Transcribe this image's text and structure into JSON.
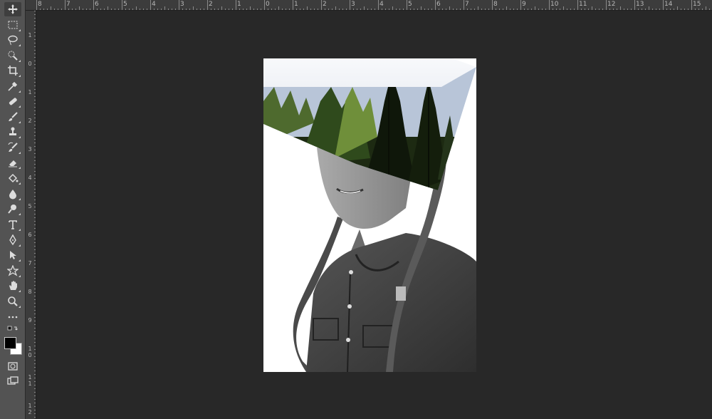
{
  "toolbar": {
    "tools": [
      {
        "name": "move-tool",
        "icon": "move-icon",
        "active": true
      },
      {
        "name": "rectangular-marquee-tool",
        "icon": "marquee-icon"
      },
      {
        "name": "lasso-tool",
        "icon": "lasso-icon"
      },
      {
        "name": "quick-selection-tool",
        "icon": "quick-selection-icon"
      },
      {
        "name": "crop-tool",
        "icon": "crop-icon"
      },
      {
        "name": "eyedropper-tool",
        "icon": "eyedropper-icon"
      },
      {
        "name": "healing-brush-tool",
        "icon": "bandage-icon"
      },
      {
        "name": "brush-tool",
        "icon": "brush-icon"
      },
      {
        "name": "clone-stamp-tool",
        "icon": "stamp-icon"
      },
      {
        "name": "history-brush-tool",
        "icon": "history-brush-icon"
      },
      {
        "name": "eraser-tool",
        "icon": "eraser-icon"
      },
      {
        "name": "paint-bucket-tool",
        "icon": "paint-bucket-icon"
      },
      {
        "name": "blur-tool",
        "icon": "drop-icon"
      },
      {
        "name": "dodge-tool",
        "icon": "dodge-icon"
      },
      {
        "name": "type-tool",
        "icon": "type-icon",
        "label": "T"
      },
      {
        "name": "pen-tool",
        "icon": "pen-icon"
      },
      {
        "name": "path-selection-tool",
        "icon": "arrow-icon"
      },
      {
        "name": "custom-shape-tool",
        "icon": "shape-icon"
      },
      {
        "name": "hand-tool",
        "icon": "hand-icon"
      },
      {
        "name": "zoom-tool",
        "icon": "zoom-icon"
      },
      {
        "name": "edit-toolbar",
        "icon": "more-icon"
      }
    ],
    "colors": {
      "foreground": "#000000",
      "background": "#ffffff"
    }
  },
  "rulers": {
    "horizontal": [
      "8",
      "7",
      "6",
      "5",
      "4",
      "3",
      "2",
      "1",
      "0",
      "1",
      "2",
      "3",
      "4",
      "5",
      "6",
      "7",
      "8",
      "9",
      "10",
      "11",
      "12",
      "13",
      "14",
      "15"
    ],
    "vertical": [
      "1",
      "0",
      "1",
      "2",
      "3",
      "4",
      "5",
      "6",
      "7",
      "8",
      "9",
      "1 0",
      "1 1",
      "1 2"
    ]
  },
  "theme": {
    "workspace": "#282828",
    "panel": "#535353",
    "ruler": "#3c3c3c"
  }
}
